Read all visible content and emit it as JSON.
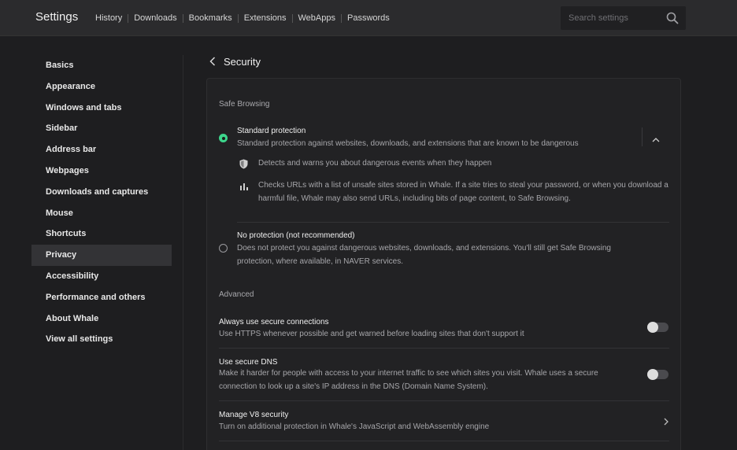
{
  "header": {
    "title": "Settings",
    "nav": [
      "History",
      "Downloads",
      "Bookmarks",
      "Extensions",
      "WebApps",
      "Passwords"
    ],
    "search_placeholder": "Search settings"
  },
  "sidebar": {
    "items": [
      {
        "label": "Basics"
      },
      {
        "label": "Appearance"
      },
      {
        "label": "Windows and tabs"
      },
      {
        "label": "Sidebar"
      },
      {
        "label": "Address bar"
      },
      {
        "label": "Webpages"
      },
      {
        "label": "Downloads and captures"
      },
      {
        "label": "Mouse"
      },
      {
        "label": "Shortcuts"
      },
      {
        "label": "Privacy",
        "active": true
      },
      {
        "label": "Accessibility"
      },
      {
        "label": "Performance and others"
      },
      {
        "label": "About Whale"
      },
      {
        "label": "View all settings"
      }
    ]
  },
  "page": {
    "title": "Security",
    "safe_browsing": {
      "label": "Safe Browsing",
      "standard": {
        "title": "Standard protection",
        "desc": "Standard protection against websites, downloads, and extensions that are known to be dangerous",
        "selected": true,
        "details": [
          {
            "icon": "shield-icon",
            "text": "Detects and warns you about dangerous events when they happen"
          },
          {
            "icon": "bar-chart-icon",
            "text": "Checks URLs with a list of unsafe sites stored in Whale. If a site tries to steal your password, or when you download a harmful file, Whale may also send URLs, including bits of page content, to Safe Browsing."
          }
        ]
      },
      "none": {
        "title": "No protection (not recommended)",
        "desc": "Does not protect you against dangerous websites, downloads, and extensions. You'll still get Safe Browsing protection, where available, in NAVER services.",
        "selected": false
      }
    },
    "advanced": {
      "label": "Advanced",
      "rows": [
        {
          "title": "Always use secure connections",
          "desc": "Use HTTPS whenever possible and get warned before loading sites that don't support it",
          "control": "toggle",
          "on": false
        },
        {
          "title": "Use secure DNS",
          "desc": "Make it harder for people with access to your internet traffic to see which sites you visit. Whale uses a secure connection to look up a site's IP address in the DNS (Domain Name System).",
          "control": "toggle",
          "on": false
        },
        {
          "title": "Manage V8 security",
          "desc": "Turn on additional protection in Whale's JavaScript and WebAssembly engine",
          "control": "chevron"
        }
      ]
    }
  },
  "colors": {
    "accent": "#3dd68c",
    "background": "#1e1e20",
    "topbar": "#2b2b2d",
    "card": "#222224"
  }
}
